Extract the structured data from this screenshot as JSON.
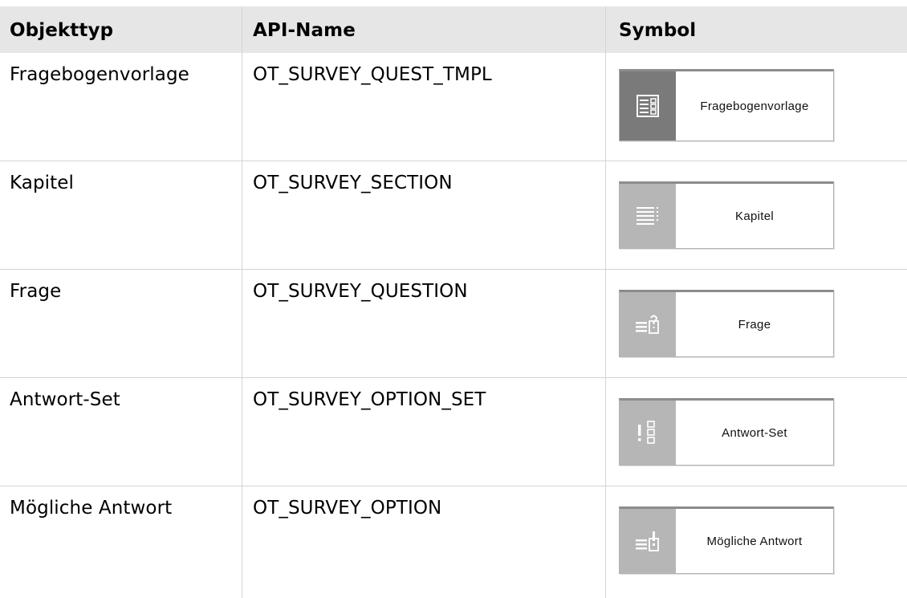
{
  "header": {
    "col1": "Objekttyp",
    "col2": "API-Name",
    "col3": "Symbol"
  },
  "rows": [
    {
      "objekttyp": "Fragebogenvorlage",
      "api_name": "OT_SURVEY_QUEST_TMPL",
      "symbol_label": "Fragebogenvorlage",
      "icon": "survey-template-icon"
    },
    {
      "objekttyp": "Kapitel",
      "api_name": "OT_SURVEY_SECTION",
      "symbol_label": "Kapitel",
      "icon": "section-lines-icon"
    },
    {
      "objekttyp": "Frage",
      "api_name": "OT_SURVEY_QUESTION",
      "symbol_label": "Frage",
      "icon": "question-icon"
    },
    {
      "objekttyp": "Antwort-Set",
      "api_name": "OT_SURVEY_OPTION_SET",
      "symbol_label": "Antwort-Set",
      "icon": "option-set-icon"
    },
    {
      "objekttyp": "Mögliche Antwort",
      "api_name": "OT_SURVEY_OPTION",
      "symbol_label": "Mögliche Antwort",
      "icon": "option-icon"
    }
  ]
}
